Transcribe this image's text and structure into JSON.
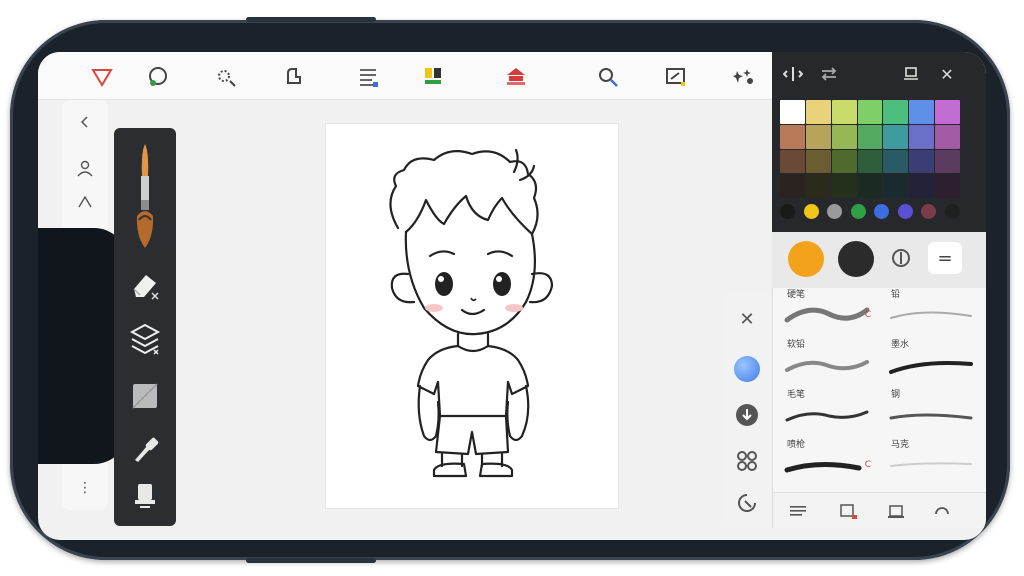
{
  "toolbar": {
    "items": [
      {
        "icon": "lasso-triangle-icon",
        "caption": ""
      },
      {
        "icon": "lasso-circle-icon",
        "caption": ""
      },
      {
        "icon": "magic-wand-icon",
        "caption": ""
      },
      {
        "icon": "transform-icon",
        "caption": ""
      },
      {
        "icon": "adjust-icon",
        "caption": ""
      },
      {
        "icon": "palette-icon",
        "caption": ""
      },
      {
        "icon": "stamp-icon",
        "caption": ""
      },
      {
        "icon": "zoom-icon",
        "caption": ""
      },
      {
        "icon": "crop-icon",
        "caption": ""
      },
      {
        "icon": "effects-icon",
        "caption": ""
      }
    ]
  },
  "left_bar": {
    "items": [
      {
        "icon": "back-icon"
      },
      {
        "icon": "person-icon"
      },
      {
        "icon": "size-slider-icon"
      },
      {
        "icon": "opacity-slider-icon"
      },
      {
        "icon": "smudge-icon"
      },
      {
        "icon": "pencil-icon"
      },
      {
        "icon": "menu-lines-icon"
      },
      {
        "icon": "more-dots-icon",
        "label": "⋮"
      }
    ]
  },
  "tool_panel": {
    "tools": [
      "brush-icon",
      "eraser-icon",
      "layers-icon",
      "fill-square-icon",
      "eyedropper-icon",
      "stamp-tool-icon"
    ]
  },
  "color_panel": {
    "header_icons": [
      "symmetry-icon",
      "swap-icon",
      "pin-icon",
      "close-icon"
    ],
    "close_glyph": "✕",
    "swatches": [
      "#ffffff",
      "#e9d27a",
      "#c9dc6a",
      "#7ecf67",
      "#4cbf7e",
      "#5f8fe6",
      "#c26cd4",
      "#b97a5a",
      "#b8a35a",
      "#96b854",
      "#53a95f",
      "#3e9c9e",
      "#6b6fc7",
      "#a35aa6",
      "#6a4a36",
      "#6c5e33",
      "#4e6a2c",
      "#2f5f3a",
      "#2a5a63",
      "#3b3d74",
      "#5b3b60",
      "#2a231f",
      "#2c2a1d",
      "#24301c",
      "#1c2b22",
      "#1a2b30",
      "#222238",
      "#2c1f2e"
    ],
    "dots": [
      "#1a1a1a",
      "#f2c417",
      "#9a9a9a",
      "#2ea043",
      "#3d6be0",
      "#5b4fd3",
      "#7a3b4a",
      "#202020"
    ],
    "primary_color": "#f3a21b",
    "secondary_color": "#2b2b2b",
    "menu_glyph": "="
  },
  "brush_panel": {
    "brushes": [
      {
        "label": "硬笔",
        "tag": "C"
      },
      {
        "label": "铅",
        "tag": ""
      },
      {
        "label": "软铅",
        "tag": ""
      },
      {
        "label": "墨水",
        "tag": ""
      },
      {
        "label": "毛笔",
        "tag": ""
      },
      {
        "label": "钢",
        "tag": ""
      },
      {
        "label": "喷枪",
        "tag": "C"
      },
      {
        "label": "马克",
        "tag": ""
      }
    ],
    "bottom_icons": [
      "list-icon",
      "layer-add-icon",
      "duplicate-icon",
      "reset-icon"
    ]
  },
  "side_column": {
    "icons": [
      "close-icon",
      "color-circle-icon",
      "download-icon",
      "grid-icon",
      "rotate-icon"
    ],
    "close_glyph": "✕"
  },
  "canvas": {
    "subject": "cartoon-boy-sketch"
  }
}
